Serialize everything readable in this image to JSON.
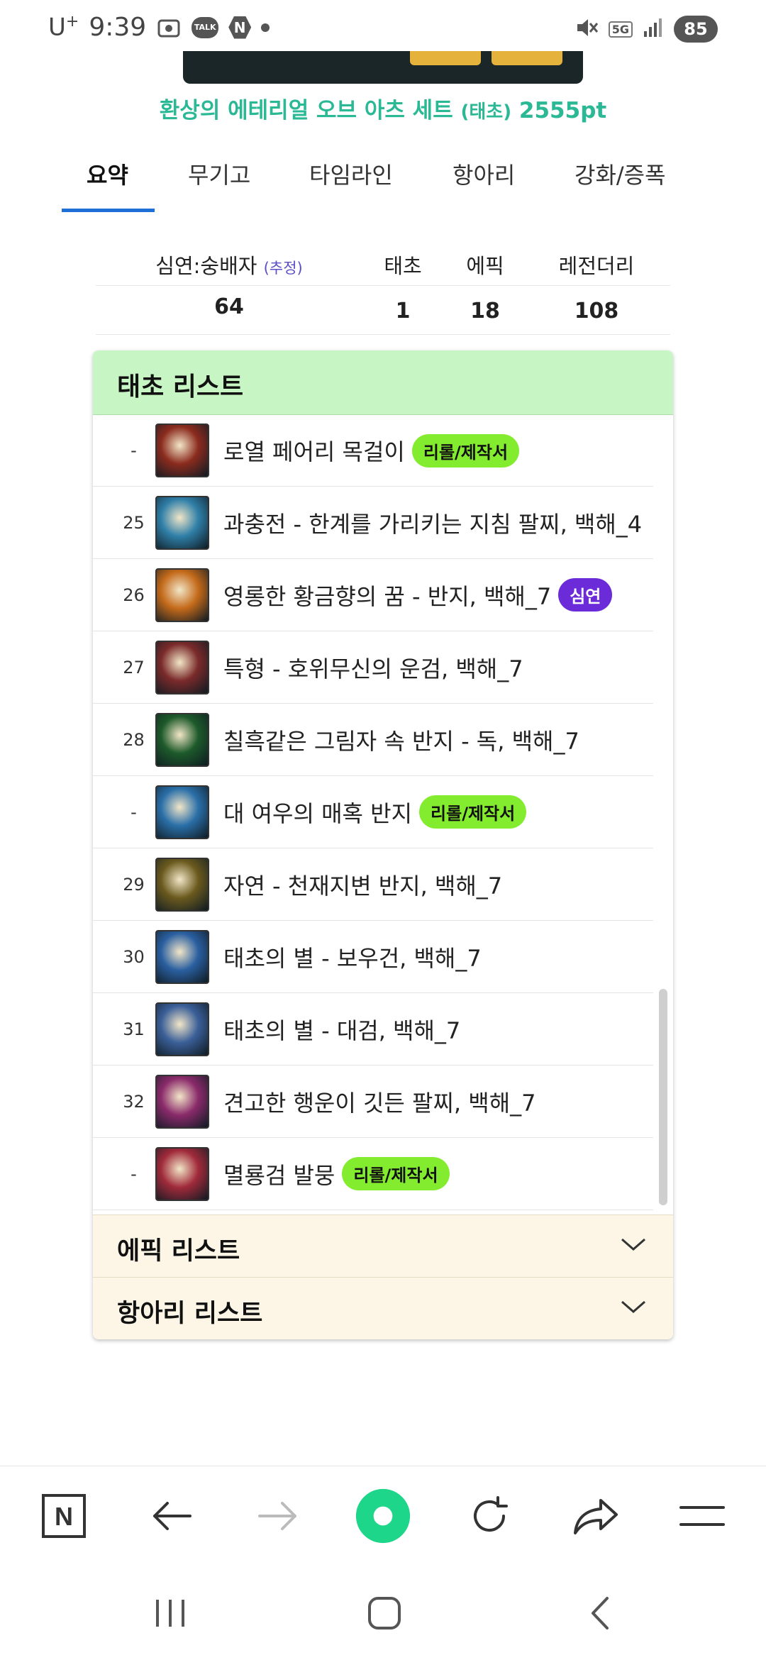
{
  "status_bar": {
    "carrier": "U",
    "carrier_sup": "+",
    "time": "9:39",
    "talk_label": "TALK",
    "n_label": "N",
    "network": "5G",
    "battery": "85"
  },
  "header": {
    "set_title": "환상의 에테리얼 오브 아츠 세트",
    "set_tier": "(태초)",
    "set_points": "2555pt"
  },
  "tabs": [
    {
      "label": "요약",
      "active": true
    },
    {
      "label": "무기고",
      "active": false
    },
    {
      "label": "타임라인",
      "active": false
    },
    {
      "label": "항아리",
      "active": false
    },
    {
      "label": "강화/증폭",
      "active": false
    }
  ],
  "summary": {
    "headers": {
      "deep": "심연:숭배자",
      "estimate": "(추정)",
      "taecho": "태초",
      "epic": "에픽",
      "legendary": "레전더리"
    },
    "values": {
      "deep": "64",
      "taecho": "1",
      "epic": "18",
      "legendary": "108"
    }
  },
  "taecho_list": {
    "title": "태초 리스트",
    "items": [
      {
        "num": "-",
        "name": "로열 페어리 목걸이",
        "badge": "리롤/제작서",
        "badge_color": "#84ec2f",
        "icon": "necklace-icon",
        "icon_color": "#8b2b1e"
      },
      {
        "num": "25",
        "name": "과충전 - 한계를 가리키는 지침 팔찌, 백해_4",
        "badge": "",
        "badge_color": "",
        "icon": "bracelet-icon",
        "icon_color": "#2f7fa8"
      },
      {
        "num": "26",
        "name": "영롱한 황금향의 꿈 - 반지, 백해_7",
        "badge": "심연",
        "badge_color": "#6b2bd9",
        "icon": "ring-icon",
        "icon_color": "#c46a1a"
      },
      {
        "num": "27",
        "name": "특형 - 호위무신의 운검, 백해_7",
        "badge": "",
        "badge_color": "",
        "icon": "sword-icon",
        "icon_color": "#7a2a2a"
      },
      {
        "num": "28",
        "name": "칠흑같은 그림자 속 반지 - 독, 백해_7",
        "badge": "",
        "badge_color": "",
        "icon": "shadow-ring-icon",
        "icon_color": "#1d5a2a"
      },
      {
        "num": "-",
        "name": "대 여우의 매혹 반지",
        "badge": "리롤/제작서",
        "badge_color": "#84ec2f",
        "icon": "fox-ring-icon",
        "icon_color": "#2a6fa8"
      },
      {
        "num": "29",
        "name": "자연 - 천재지변 반지, 백해_7",
        "badge": "",
        "badge_color": "",
        "icon": "nature-ring-icon",
        "icon_color": "#6b5a1e"
      },
      {
        "num": "30",
        "name": "태초의 별 - 보우건, 백해_7",
        "badge": "",
        "badge_color": "",
        "icon": "bowgun-icon",
        "icon_color": "#2a5fa0"
      },
      {
        "num": "31",
        "name": "태초의 별 - 대검, 백해_7",
        "badge": "",
        "badge_color": "",
        "icon": "greatsword-icon",
        "icon_color": "#3a5f98"
      },
      {
        "num": "32",
        "name": "견고한 행운이 깃든 팔찌, 백해_7",
        "badge": "",
        "badge_color": "",
        "icon": "lucky-bracelet-icon",
        "icon_color": "#8a2a6a"
      },
      {
        "num": "-",
        "name": "멸룡검 발뭉",
        "badge": "리롤/제작서",
        "badge_color": "#84ec2f",
        "icon": "dragon-sword-icon",
        "icon_color": "#a02a3a"
      }
    ]
  },
  "epic_list": {
    "title": "에픽 리스트"
  },
  "jar_list": {
    "title": "항아리 리스트"
  },
  "colors": {
    "accent_tab": "#1e6fd6",
    "title_green": "#2bb894",
    "panel_head": "#c7f5c4",
    "accordion_bg": "#fdf6e7",
    "home_green": "#1ed68a"
  },
  "browser_bar": {
    "icons": [
      "naver-n-icon",
      "back-arrow-icon",
      "forward-arrow-icon",
      "home-green-circle-icon",
      "refresh-icon",
      "share-icon",
      "menu-icon"
    ],
    "n_label": "N"
  },
  "system_nav": {
    "icons": [
      "recent-apps-icon",
      "home-icon",
      "back-icon"
    ]
  }
}
